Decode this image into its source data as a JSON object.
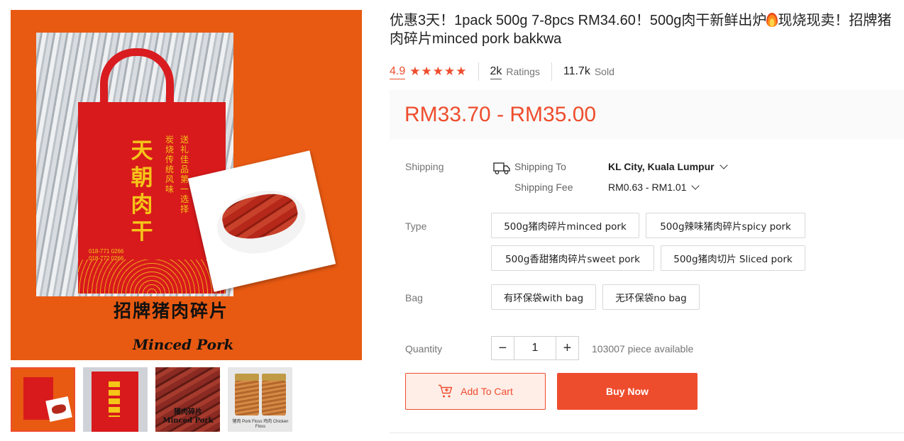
{
  "product": {
    "title_pre": "优惠3天！1pack 500g 7-8pcs RM34.60！500g肉干新鲜出炉",
    "title_post": "现烧现卖！招牌猪肉碎片minced pork bakkwa",
    "rating": "4.9",
    "ratings_count": "2k",
    "ratings_label": "Ratings",
    "sold_count": "11.7k",
    "sold_label": "Sold",
    "price": "RM33.70 - RM35.00"
  },
  "gallery": {
    "main_image": {
      "bag_brand": "天朝肉干",
      "bag_slogan_1": "炭烧传统风味",
      "bag_slogan_2": "送礼佳品第一选择",
      "bag_phone_1": "018-771 0266",
      "bag_phone_2": "018-772 0266",
      "caption_cn": "招牌猪肉碎片",
      "caption_en": "Minced Pork"
    },
    "thumbnails": [
      {
        "label": "",
        "active": true
      },
      {
        "label": "",
        "active": false
      },
      {
        "label": "猪肉碎片 Minced Pork",
        "active": false
      },
      {
        "label": "猪肉 Pork Floss 鸡肉 Chicken Floss",
        "active": false
      }
    ]
  },
  "shipping": {
    "label": "Shipping",
    "to_label": "Shipping To",
    "to_value": "KL City, Kuala Lumpur",
    "fee_label": "Shipping Fee",
    "fee_value": "RM0.63 - RM1.01"
  },
  "type": {
    "label": "Type",
    "options": [
      "500g猪肉碎片minced pork",
      "500g辣味猪肉碎片spicy pork",
      "500g香甜猪肉碎片sweet pork",
      "500g猪肉切片 Sliced pork"
    ]
  },
  "bag": {
    "label": "Bag",
    "options": [
      "有环保袋with bag",
      "无环保袋no bag"
    ]
  },
  "quantity": {
    "label": "Quantity",
    "value": "1",
    "minus": "−",
    "plus": "+",
    "available": "103007 piece available"
  },
  "actions": {
    "add_to_cart": "Add To Cart",
    "buy_now": "Buy Now"
  },
  "colors": {
    "accent": "#ee4d2d",
    "image_bg": "#e85a12",
    "bag_red": "#d81a1c",
    "bag_gold": "#f5c518"
  }
}
